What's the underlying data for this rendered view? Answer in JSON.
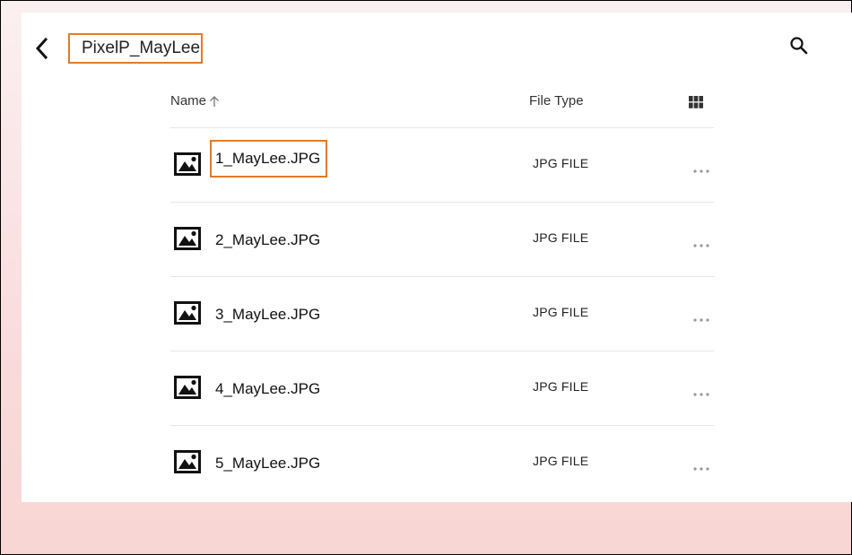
{
  "header": {
    "folder_title": "PixelP_MayLee"
  },
  "columns": {
    "name_label": "Name",
    "type_label": "File Type"
  },
  "files": [
    {
      "name": "1_MayLee.JPG",
      "type": "JPG FILE",
      "highlighted": true
    },
    {
      "name": "2_MayLee.JPG",
      "type": "JPG FILE",
      "highlighted": false
    },
    {
      "name": "3_MayLee.JPG",
      "type": "JPG FILE",
      "highlighted": false
    },
    {
      "name": "4_MayLee.JPG",
      "type": "JPG FILE",
      "highlighted": false
    },
    {
      "name": "5_MayLee.JPG",
      "type": "JPG FILE",
      "highlighted": false
    }
  ],
  "icons": {
    "back": "chevron-left-icon",
    "search": "search-icon",
    "sort": "arrow-up-icon",
    "view": "grid-view-icon",
    "file": "image-file-icon",
    "more": "more-horizontal-icon"
  },
  "colors": {
    "highlight": "#e07b2c",
    "background_top": "#fbf0f1",
    "background_bottom": "#f8d6d3"
  }
}
